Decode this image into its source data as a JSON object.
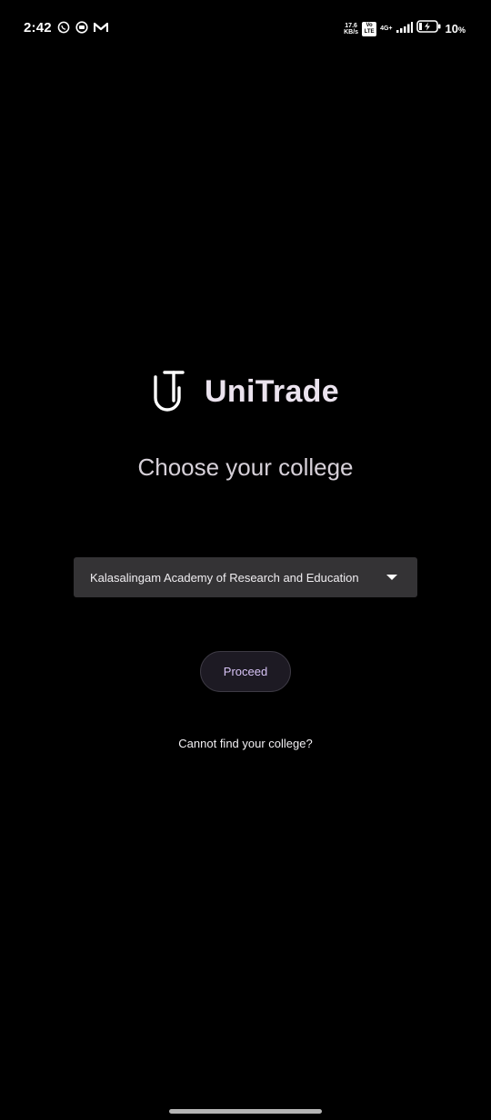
{
  "status_bar": {
    "time": "2:42",
    "net_speed_value": "17.6",
    "net_speed_unit": "KB/s",
    "volte_label": "Vo LTE",
    "network_type": "4G+",
    "battery_percent": "10",
    "battery_unit": "%",
    "icons": [
      "whatsapp-icon",
      "app-icon",
      "gmail-icon",
      "signal-icon",
      "battery-charging-icon"
    ]
  },
  "brand": {
    "name": "UniTrade"
  },
  "title": "Choose your college",
  "college_select": {
    "selected": "Kalasalingam Academy of Research and Education"
  },
  "proceed_button": {
    "label": "Proceed"
  },
  "help_link": {
    "label": "Cannot find your college?"
  },
  "colors": {
    "background": "#000000",
    "dropdown_bg": "#343335",
    "button_bg": "#1d1a23",
    "button_text": "#d7c3f5"
  }
}
